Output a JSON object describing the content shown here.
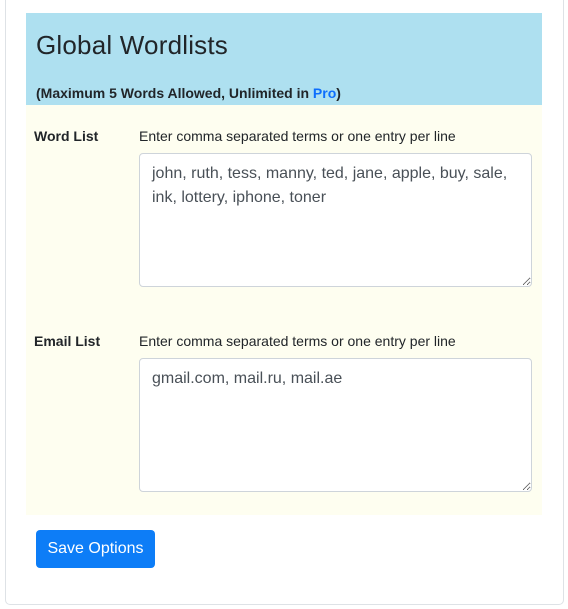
{
  "header": {
    "title": "Global Wordlists",
    "subtitle_prefix": "(Maximum 5 Words Allowed, Unlimited in ",
    "subtitle_link": "Pro",
    "subtitle_suffix": ")"
  },
  "word_list": {
    "label": "Word List",
    "hint": "Enter comma separated terms or one entry per line",
    "value": "john, ruth, tess, manny, ted, jane, apple, buy, sale, ink, lottery, iphone, toner"
  },
  "email_list": {
    "label": "Email List",
    "hint": "Enter comma separated terms or one entry per line",
    "value": "gmail.com, mail.ru, mail.ae"
  },
  "actions": {
    "save_label": "Save Options"
  },
  "colors": {
    "header_bg": "#aee0f0",
    "panel_bg": "#fefef0",
    "link": "#0d6efd",
    "button_bg": "#0d7df7"
  }
}
